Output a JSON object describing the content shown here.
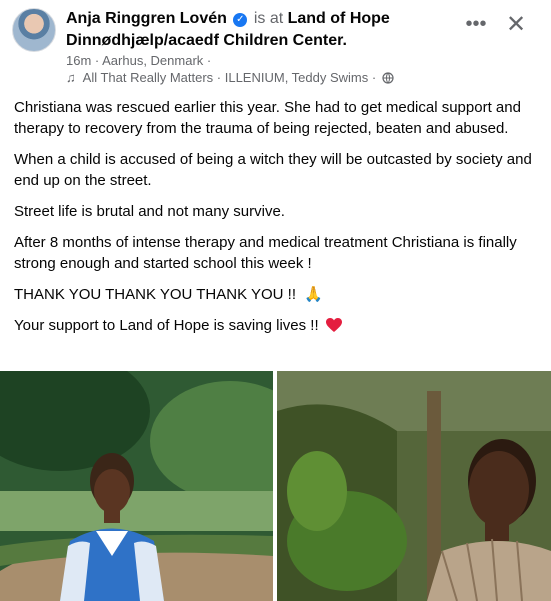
{
  "header": {
    "author": "Anja Ringgren Lovén",
    "is_at": "is at",
    "place": "Land of Hope Dinnødhjælp/acaedf Children Center.",
    "time_location": "16m · Aarhus, Denmark ·",
    "music": "All That Really Matters · ILLENIUM, Teddy Swims ·",
    "more_icon": "more-horizontal-icon",
    "close_icon": "close-icon",
    "verified_icon": "verified-badge-icon",
    "privacy_icon": "globe-icon"
  },
  "post": {
    "paragraphs": [
      "Christiana was rescued earlier this year. She had to get medical support and therapy to recovery from the trauma of being rejected, beaten and abused.",
      "When a child is accused of being a witch they will be outcasted by society and end up on the street.",
      "Street life is brutal and not many survive.",
      "After 8 months of intense therapy and medical treatment Christiana is finally strong enough and started school this week !",
      "THANK YOU THANK YOU THANK YOU !!",
      "Your support to Land of Hope is saving lives !!"
    ]
  },
  "photos": {
    "count": 2,
    "left_icon": "photo-girl-school-uniform",
    "right_icon": "photo-girl-bushes"
  },
  "colors": {
    "text": "#050505",
    "secondary": "#65676b",
    "accent": "#1877f2",
    "heart": "#e41e3f"
  }
}
